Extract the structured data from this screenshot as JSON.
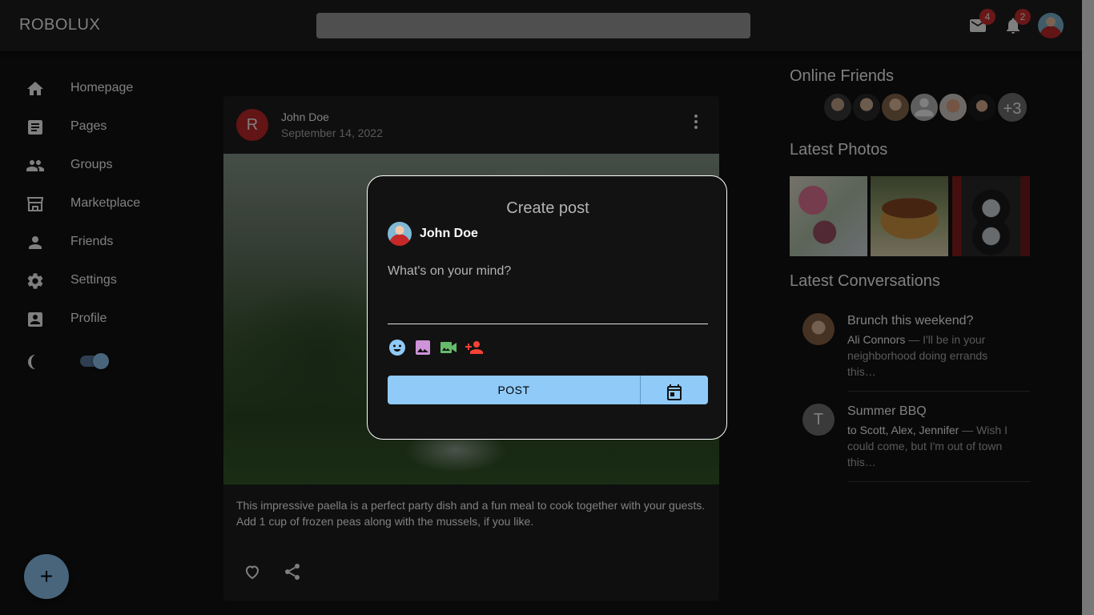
{
  "app": {
    "title": "ROBOLUX"
  },
  "topbar": {
    "search_placeholder": "",
    "mail_badge": "4",
    "notifications_badge": "2"
  },
  "sidebar": {
    "items": [
      {
        "label": "Homepage",
        "icon": "home-icon"
      },
      {
        "label": "Pages",
        "icon": "article-icon"
      },
      {
        "label": "Groups",
        "icon": "group-icon"
      },
      {
        "label": "Marketplace",
        "icon": "storefront-icon"
      },
      {
        "label": "Friends",
        "icon": "person-icon"
      },
      {
        "label": "Settings",
        "icon": "gear-icon"
      },
      {
        "label": "Profile",
        "icon": "account-box-icon"
      }
    ],
    "dark_mode_enabled": true
  },
  "fab": {
    "label": "+"
  },
  "post": {
    "avatar_letter": "R",
    "author": "John Doe",
    "date": "September 14, 2022",
    "text": "This impressive paella is a perfect party dish and a fun meal to cook together with your guests. Add 1 cup of frozen peas along with the mussels, if you like."
  },
  "right": {
    "online_friends_title": "Online Friends",
    "online_friends_more": "+3",
    "latest_photos_title": "Latest Photos",
    "latest_conversations_title": "Latest Conversations",
    "conversations": [
      {
        "title": "Brunch this weekend?",
        "who": "Ali Connors",
        "snippet": " — I'll be in your neighborhood doing errands this…"
      },
      {
        "avatar_letter": "T",
        "title": "Summer BBQ",
        "who": "to Scott, Alex, Jennifer",
        "snippet": " — Wish I could come, but I'm out of town this…"
      }
    ]
  },
  "modal": {
    "title": "Create post",
    "user": "John Doe",
    "placeholder": "What's on your mind?",
    "post_label": "POST"
  },
  "colors": {
    "accent": "#90caf9",
    "badge": "#d32f2f",
    "background": "#121212",
    "surface": "#1e1e1e"
  }
}
